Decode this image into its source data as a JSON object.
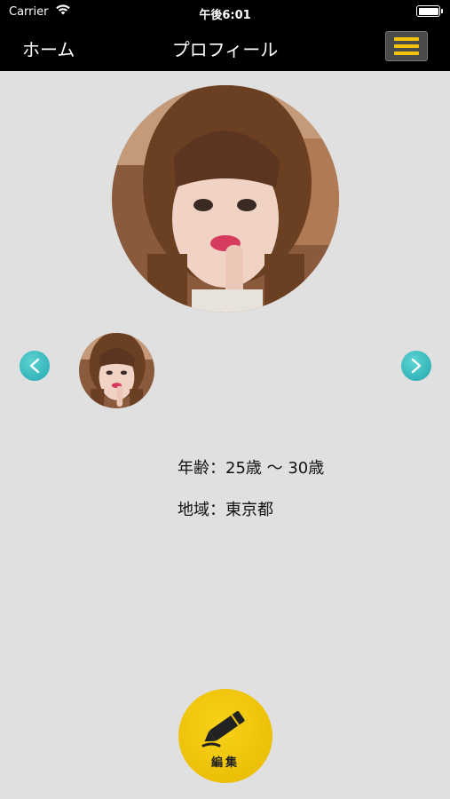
{
  "status_bar": {
    "carrier": "Carrier",
    "time": "午後6:01"
  },
  "nav": {
    "home_label": "ホーム",
    "title": "プロフィール"
  },
  "profile": {
    "age": "年齢：25歳 〜 30歳",
    "area": "地域：東京都"
  },
  "edit_button": {
    "label": "編集"
  },
  "colors": {
    "accent": "#f2c40c",
    "arrow": "#2bb0b8",
    "background": "#e0e0e0"
  }
}
